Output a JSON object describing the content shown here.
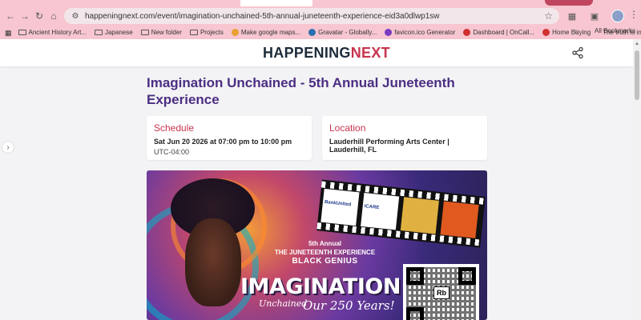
{
  "browser": {
    "url": "happeningnext.com/event/imagination-unchained-5th-annual-juneteenth-experience-eid3a0dlwp1sw",
    "bookmarks": [
      {
        "label": "Ancient History Art...",
        "kind": "folder"
      },
      {
        "label": "Japanese",
        "kind": "folder"
      },
      {
        "label": "New folder",
        "kind": "folder"
      },
      {
        "label": "Projects",
        "kind": "folder"
      },
      {
        "label": "Make google maps...",
        "kind": "site"
      },
      {
        "label": "Gravatar - Globally...",
        "kind": "site"
      },
      {
        "label": "favicon.ico Generator",
        "kind": "site"
      },
      {
        "label": "Dashboard | OnCall...",
        "kind": "site"
      },
      {
        "label": "Home Buying",
        "kind": "site"
      },
      {
        "label": "The truth is in the d...",
        "kind": "site"
      }
    ],
    "all_bookmarks": "All Bookmarks"
  },
  "site": {
    "logo_part1": "HAPPENING",
    "logo_part2": "NEXT"
  },
  "event": {
    "title": "Imagination Unchained - 5th Annual Juneteenth Experience",
    "schedule": {
      "heading": "Schedule",
      "datetime": "Sat Jun 20 2026 at 07:00 pm to 10:00 pm",
      "timezone": "UTC-04:00"
    },
    "location": {
      "heading": "Location",
      "venue": "Lauderhill Performing Arts Center | Lauderhill, FL"
    }
  },
  "banner": {
    "line1": "5th Annual",
    "line2": "THE JUNETEENTH EXPERIENCE",
    "line3": "BLACK GENIUS",
    "big": "IMAGINATION",
    "script": "Unchained",
    "years": "Our 250 Years!",
    "sponsor1": "BankUnited",
    "sponsor2": "ICARE",
    "qr_label": "Rb"
  },
  "colors": {
    "title": "#4b2e83",
    "accent": "#c8344d",
    "browser_chrome": "#f7c6d0"
  }
}
